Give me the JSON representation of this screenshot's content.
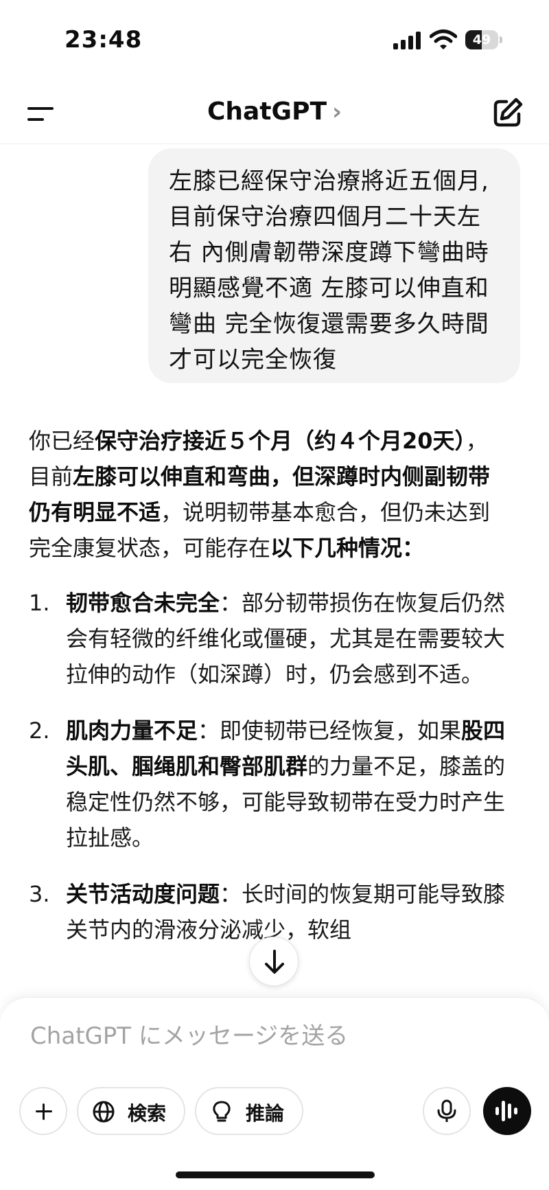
{
  "status_bar": {
    "time": "23:48",
    "battery": "49",
    "battery_level": 0.49
  },
  "header": {
    "title": "ChatGPT",
    "chevron": "›",
    "menu_icon": "menu-icon",
    "new_chat_icon": "edit-icon"
  },
  "user_message": "左膝已經保守治療將近五個月,\n目前保守治療四個月二十天左\n右 內側膚韌帶深度蹲下彎曲時\n明顯感覺不適 左膝可以伸直和\n彎曲 完全恢復還需要多久時間\n才可以完全恢復",
  "assistant": {
    "intro": [
      {
        "text": "你已经",
        "bold": false
      },
      {
        "text": "保守治疗接近５个月（约４个月20天）",
        "bold": true
      },
      {
        "text": "，目前",
        "bold": false
      },
      {
        "text": "左膝可以伸直和弯曲，但深蹲时内侧副韧带仍有明显不适",
        "bold": true
      },
      {
        "text": "，说明韧带基本愈合，但仍未达到完全康复状态，可能存在",
        "bold": false
      },
      {
        "text": "以下几种情况：",
        "bold": true
      }
    ],
    "items": [
      {
        "num": "1.",
        "parts": [
          {
            "text": "韧带愈合未完全",
            "bold": true
          },
          {
            "text": "：部分韧带损伤在恢复后仍然会有轻微的纤维化或僵硬，尤其是在需要较大拉伸的动作（如深蹲）时，仍会感到不适。",
            "bold": false
          }
        ]
      },
      {
        "num": "2.",
        "parts": [
          {
            "text": "肌肉力量不足",
            "bold": true
          },
          {
            "text": "：即使韧带已经恢复，如果",
            "bold": false
          },
          {
            "text": "股四头肌、腘绳肌和臀部肌群",
            "bold": true
          },
          {
            "text": "的力量不足，膝盖的稳定性仍然不够，可能导致韧带在受力时产生拉扯感。",
            "bold": false
          }
        ]
      },
      {
        "num": "3.",
        "parts": [
          {
            "text": "关节活动度问题",
            "bold": true
          },
          {
            "text": "：长时间的恢复期可能导致膝关节内的滑液分泌减少，软组",
            "bold": false
          }
        ]
      }
    ]
  },
  "composer": {
    "placeholder": "ChatGPT にメッセージを送る",
    "search_label": "検索",
    "reason_label": "推論"
  },
  "icons": {
    "scroll": "arrow-down-icon",
    "plus": "plus-icon",
    "search": "globe-icon",
    "reason": "lightbulb-icon",
    "mic": "mic-icon",
    "voice": "voice-wave-icon"
  }
}
